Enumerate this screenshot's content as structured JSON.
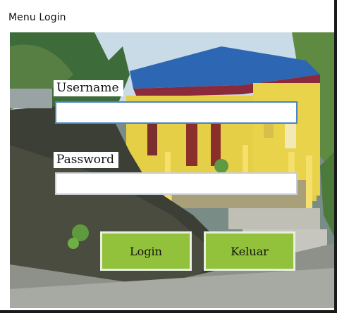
{
  "window": {
    "title": "Menu Login"
  },
  "form": {
    "username_label": "Username",
    "username_value": "",
    "password_label": "Password",
    "password_value": ""
  },
  "buttons": {
    "login_label": "Login",
    "exit_label": "Keluar"
  },
  "colors": {
    "button_green": "#92c13b",
    "focus_border": "#4a86c5"
  }
}
